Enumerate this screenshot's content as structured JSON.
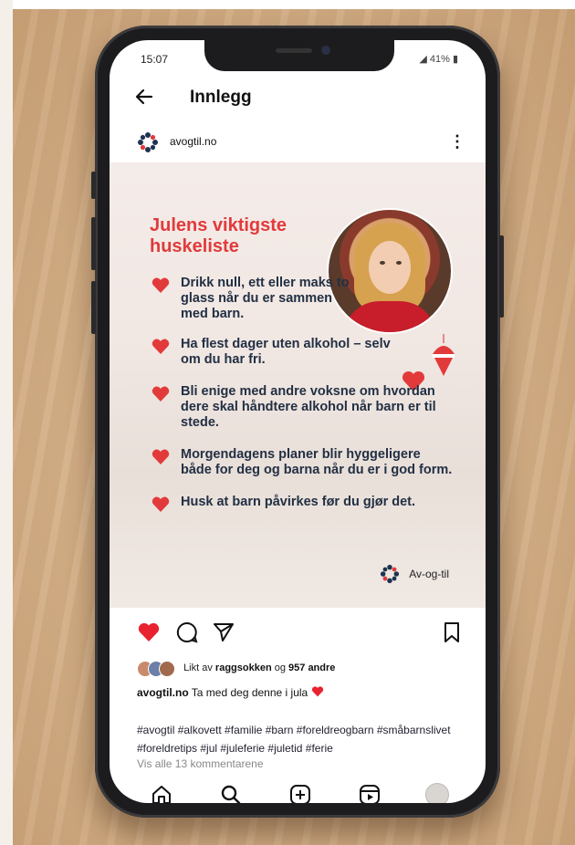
{
  "status_bar": {
    "time": "15:07",
    "battery": "41%"
  },
  "header": {
    "title": "Innlegg"
  },
  "account": {
    "username": "avogtil.no"
  },
  "post": {
    "title": "Julens viktigste huskeliste",
    "items": [
      "Drikk null, ett eller maks to glass når du er sammen med barn.",
      "Ha flest dager uten alkohol – selv om du har fri.",
      "Bli enige med andre voksne om hvordan dere skal håndtere alkohol når barn er til stede.",
      "Morgendagens planer blir hyggeligere både for deg og barna når du er i god form.",
      "Husk at barn påvirkes før du gjør det."
    ],
    "brand": "Av-og-til"
  },
  "engagement": {
    "likes_prefix": "Likt av ",
    "likes_user": "raggsokken",
    "likes_middle": " og ",
    "likes_count": "957 andre",
    "caption_user": "avogtil.no",
    "caption_text": " Ta med deg denne i jula",
    "hashtags": "#avogtil #alkovett #familie #barn #foreldreogbarn #småbarnslivet #foreldretips #jul #juleferie #juletid #ferie",
    "view_comments": "Vis alle 13 kommentarene"
  },
  "icons": {
    "back": "back-arrow-icon",
    "more": "more-vertical-icon",
    "like": "heart-icon",
    "comment": "comment-icon",
    "share": "send-icon",
    "save": "bookmark-icon",
    "nav": [
      "home-icon",
      "search-icon",
      "create-icon",
      "reels-icon",
      "profile-icon"
    ]
  },
  "colors": {
    "accent_red": "#e23a3a",
    "text_dark": "#223044"
  }
}
